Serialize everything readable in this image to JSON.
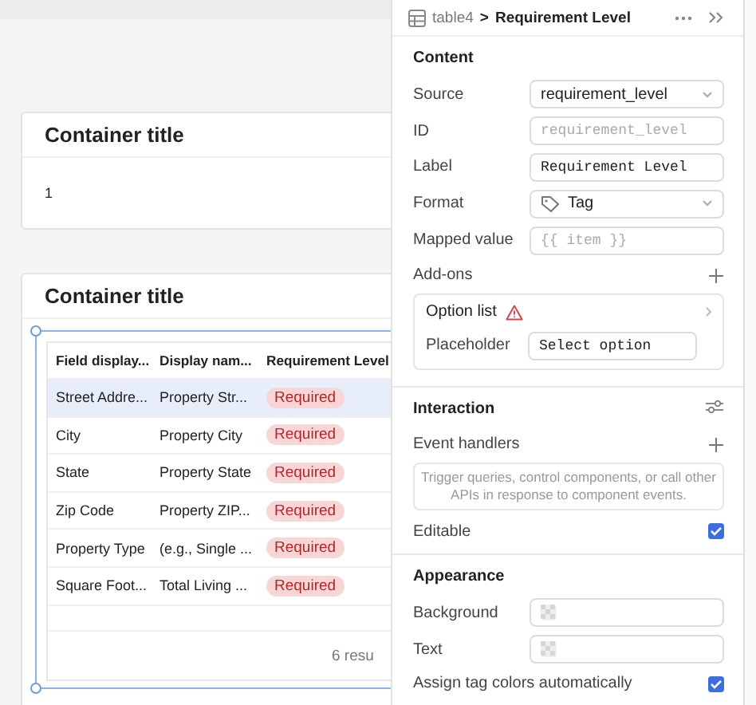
{
  "containers": [
    {
      "kind": "text",
      "title": "Container title",
      "body": "1"
    },
    {
      "kind": "table",
      "title": "Container title",
      "table": {
        "columns": [
          "Field display...",
          "Display nam...",
          "Requirement Level"
        ],
        "rows": [
          {
            "cells": [
              "Street Addre...",
              "Property Str...",
              "Required"
            ],
            "selected": true
          },
          {
            "cells": [
              "City",
              "Property City",
              "Required"
            ],
            "selected": false
          },
          {
            "cells": [
              "State",
              "Property State",
              "Required"
            ],
            "selected": false
          },
          {
            "cells": [
              "Zip Code",
              "Property ZIP...",
              "Required"
            ],
            "selected": false
          },
          {
            "cells": [
              "Property Type",
              "(e.g., Single ...",
              "Required"
            ],
            "selected": false
          },
          {
            "cells": [
              "Square Foot...",
              "Total Living ...",
              "Required"
            ],
            "selected": false
          }
        ],
        "footer": "6 resu"
      }
    }
  ],
  "inspector": {
    "breadcrumb": {
      "parent": "table4",
      "separator": ">",
      "current": "Requirement Level"
    },
    "content": {
      "title": "Content",
      "fields": [
        {
          "label": "Source",
          "kind": "select",
          "value": "requirement_level"
        },
        {
          "label": "ID",
          "kind": "input",
          "placeholder": "requirement_level"
        },
        {
          "label": "Label",
          "kind": "input",
          "value": "Requirement Level"
        },
        {
          "label": "Format",
          "kind": "tag-select",
          "value": "Tag"
        },
        {
          "label": "Mapped value",
          "kind": "input",
          "placeholder": "{{ item }}"
        }
      ],
      "add_ons": {
        "label": "Add-ons",
        "items": [
          {
            "title": "Option list",
            "warning": true,
            "fields": [
              {
                "label": "Placeholder",
                "value": "Select option"
              }
            ]
          }
        ]
      }
    },
    "interaction": {
      "title": "Interaction",
      "event_handlers": "Event handlers",
      "empty_text": "Trigger queries, control components, or call other APIs in response to component events.",
      "editable": {
        "label": "Editable",
        "checked": true
      }
    },
    "appearance": {
      "title": "Appearance",
      "fields": [
        {
          "label": "Background"
        },
        {
          "label": "Text"
        }
      ],
      "auto_colors": {
        "label": "Assign tag colors automatically",
        "checked": true
      }
    }
  }
}
